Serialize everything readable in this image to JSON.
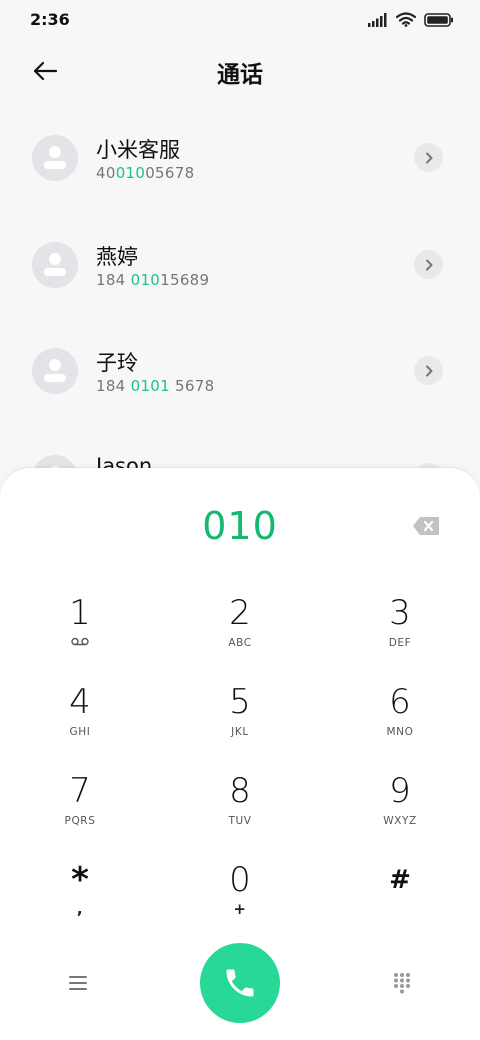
{
  "status_bar": {
    "time": "2:36"
  },
  "header": {
    "title": "通话"
  },
  "contacts": [
    {
      "name": "小米客服",
      "number_parts": [
        "40",
        "010",
        "05678"
      ]
    },
    {
      "name": "燕婷",
      "number_parts": [
        "184 ",
        "010",
        "15689"
      ]
    },
    {
      "name": "子玲",
      "number_parts": [
        "184 ",
        "0101",
        " 5678"
      ]
    },
    {
      "name": "Jason",
      "number_parts": [
        "",
        "",
        ""
      ]
    }
  ],
  "dialer": {
    "input": "010",
    "keys": [
      {
        "digit": "1",
        "letters": ""
      },
      {
        "digit": "2",
        "letters": "ABC"
      },
      {
        "digit": "3",
        "letters": "DEF"
      },
      {
        "digit": "4",
        "letters": "GHI"
      },
      {
        "digit": "5",
        "letters": "JKL"
      },
      {
        "digit": "6",
        "letters": "MNO"
      },
      {
        "digit": "7",
        "letters": "PQRS"
      },
      {
        "digit": "8",
        "letters": "TUV"
      },
      {
        "digit": "9",
        "letters": "WXYZ"
      },
      {
        "digit": "*",
        "letters": ","
      },
      {
        "digit": "0",
        "letters": "+"
      },
      {
        "digit": "#",
        "letters": ""
      }
    ]
  },
  "colors": {
    "accent": "#14b86e",
    "call_button": "#27d897",
    "highlight": "#1cc38a"
  },
  "icons": {
    "back": "arrow-left-icon",
    "backspace": "backspace-icon",
    "voicemail": "voicemail-icon",
    "menu": "menu-icon",
    "call": "phone-icon",
    "dialpad": "dialpad-icon",
    "row_arrow": "chevron-right-icon"
  }
}
